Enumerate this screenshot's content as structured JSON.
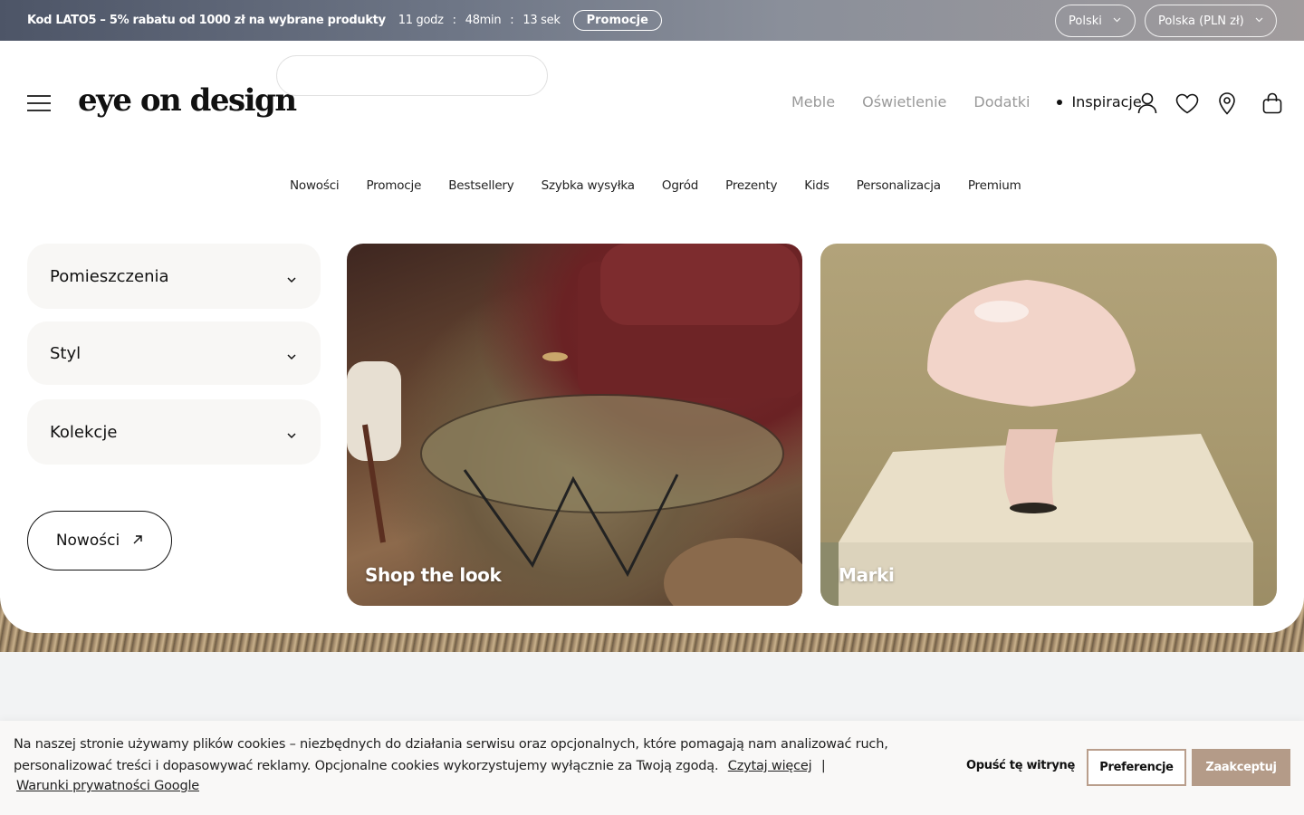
{
  "topbar": {
    "promo_text": "Kod LATO5 – 5% rabatu od 1000 zł na wybrane produkty",
    "timer": {
      "hours": "11 godz",
      "sep1": ":",
      "minutes": "48min",
      "sep2": ":",
      "seconds": "13 sek"
    },
    "promo_button": "Promocje",
    "language": "Polski",
    "country_currency": "Polska (PLN zł)"
  },
  "header": {
    "logo_text": "eye on design",
    "search": {
      "placeholder": "",
      "value": ""
    },
    "nav": [
      {
        "label": "Meble"
      },
      {
        "label": "Oświetlenie"
      },
      {
        "label": "Dodatki"
      },
      {
        "label": "Inspiracje"
      }
    ],
    "icons": [
      "user-icon",
      "heart-icon",
      "location-pin-icon",
      "shopping-bag-icon"
    ]
  },
  "subnav": [
    "Nowości",
    "Promocje",
    "Bestsellery",
    "Szybka wysyłka",
    "Ogród",
    "Prezenty",
    "Kids",
    "Personalizacja",
    "Premium"
  ],
  "filters": [
    {
      "label": "Pomieszczenia"
    },
    {
      "label": "Styl"
    },
    {
      "label": "Kolekcje"
    }
  ],
  "new_button": {
    "label": "Nowości",
    "icon": "arrow-up-right-icon"
  },
  "tiles": [
    {
      "label": "Shop the look"
    },
    {
      "label": "Marki"
    }
  ],
  "cookie": {
    "text_line1": "Na naszej stronie używamy plików cookies – niezbędnych do działania serwisu oraz opcjonalnych, które pomagają nam analizować ruch,",
    "text_line2": "personalizować treści i dopasowywać reklamy. Opcjonalne cookies wykorzystujemy wyłącznie za Twoją zgodą.",
    "read_more": "Czytaj więcej",
    "separator": "|",
    "google_link": "Warunki prywatności Google",
    "leave_label": "Opuść tę witrynę",
    "preferences_label": "Preferencje",
    "accept_label": "Zaakceptuj"
  },
  "colors": {
    "accent": "#b49b88",
    "logo_dot": "#e0337a",
    "nav_inactive": "#999999"
  }
}
